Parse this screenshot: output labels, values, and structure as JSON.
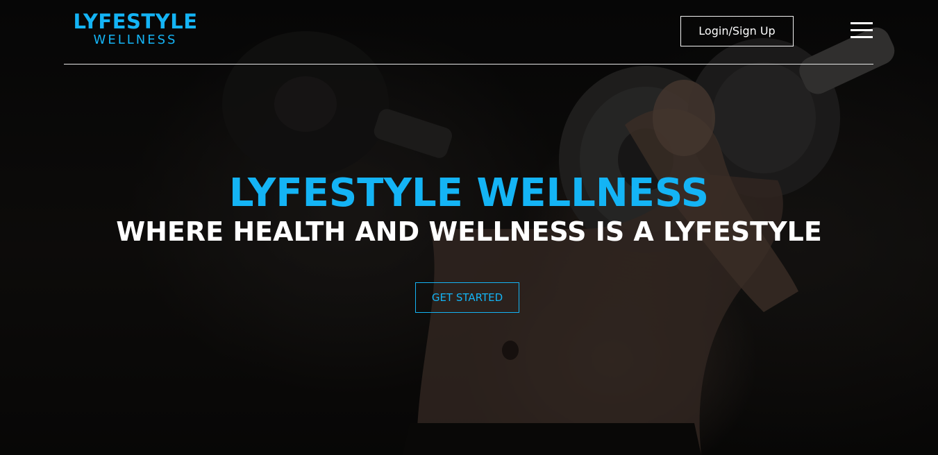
{
  "header": {
    "logo": {
      "line1": "LYFESTYLE",
      "line2": "WELLNESS"
    },
    "login_label": "Login/Sign Up",
    "menu_icon": "hamburger-menu-icon"
  },
  "hero": {
    "title": "LYFESTYLE WELLNESS",
    "subtitle": "WHERE HEALTH AND WELLNESS IS A LYFESTYLE",
    "cta_label": "GET STARTED",
    "background_image": "person-lifting-barbell-photo"
  },
  "colors": {
    "accent": "#14b4f5",
    "text_light": "#ffffff",
    "background": "#0b0b0b"
  }
}
